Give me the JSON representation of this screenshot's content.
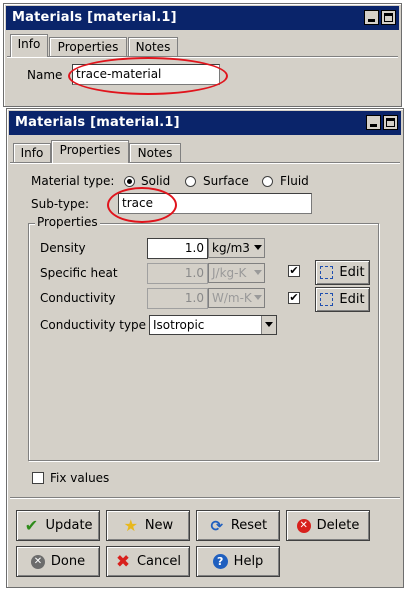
{
  "window_back": {
    "title": "Materials [material.1]",
    "tabs": [
      "Info",
      "Properties",
      "Notes"
    ],
    "name_label": "Name",
    "name_value": "trace-material"
  },
  "window_front": {
    "title": "Materials [material.1]",
    "tabs": [
      "Info",
      "Properties",
      "Notes"
    ],
    "material_type": {
      "label": "Material type:",
      "options": [
        "Solid",
        "Surface",
        "Fluid"
      ],
      "selected": "Solid"
    },
    "subtype": {
      "label": "Sub-type:",
      "value": "trace"
    },
    "properties_group": {
      "title": "Properties",
      "density": {
        "label": "Density",
        "value": "1.0",
        "unit": "kg/m3"
      },
      "specific_heat": {
        "label": "Specific heat",
        "value": "1.0",
        "unit": "J/kg-K",
        "checked": true,
        "edit_label": "Edit"
      },
      "conductivity": {
        "label": "Conductivity",
        "value": "1.0",
        "unit": "W/m-K",
        "checked": true,
        "edit_label": "Edit"
      },
      "conductivity_type": {
        "label": "Conductivity type",
        "value": "Isotropic"
      }
    },
    "fix_values_label": "Fix values",
    "buttons": {
      "update": "Update",
      "new": "New",
      "reset": "Reset",
      "delete": "Delete",
      "done": "Done",
      "cancel": "Cancel",
      "help": "Help"
    }
  },
  "colors": {
    "titlebar": "#0a246a",
    "annotation": "#e0141c",
    "panel": "#d4d0c8"
  }
}
